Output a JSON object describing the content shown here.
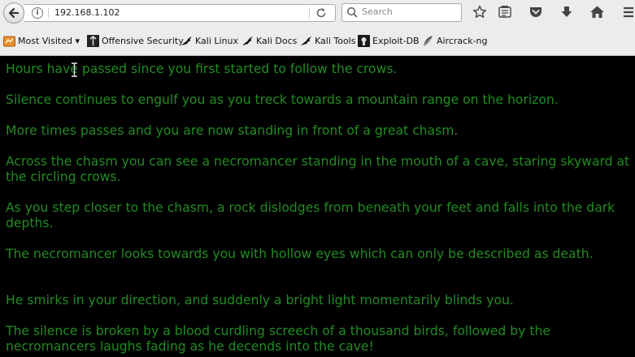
{
  "browser": {
    "url": "192.168.1.102",
    "search_placeholder": "Search"
  },
  "bookmarks": [
    {
      "label": "Most Visited ▾"
    },
    {
      "label": "Offensive Security"
    },
    {
      "label": "Kali Linux"
    },
    {
      "label": "Kali Docs"
    },
    {
      "label": "Kali Tools"
    },
    {
      "label": "Exploit-DB"
    },
    {
      "label": "Aircrack-ng"
    }
  ],
  "content": {
    "paragraphs": [
      "Hours have passed since you first started to follow the crows.",
      "Silence continues to engulf you as you treck towards a mountain range on the horizon.",
      "More times passes and you are now standing in front of a great chasm.",
      "Across the chasm you can see a necromancer standing in the mouth of a cave, staring skyward at the circling crows.",
      "As you step closer to the chasm, a rock dislodges from beneath your feet and falls into the dark depths.",
      "The necromancer looks towards you with hollow eyes which can only be described as death.",
      "He smirks in your direction, and suddenly a bright light momentarily blinds you.",
      "The silence is broken by a blood curdling screech of a thousand birds, followed by the necromancers laughs fading as he decends into the cave!"
    ]
  },
  "colors": {
    "page_background": "#000000",
    "text": "#228b22",
    "toolbar": "#ececec"
  }
}
